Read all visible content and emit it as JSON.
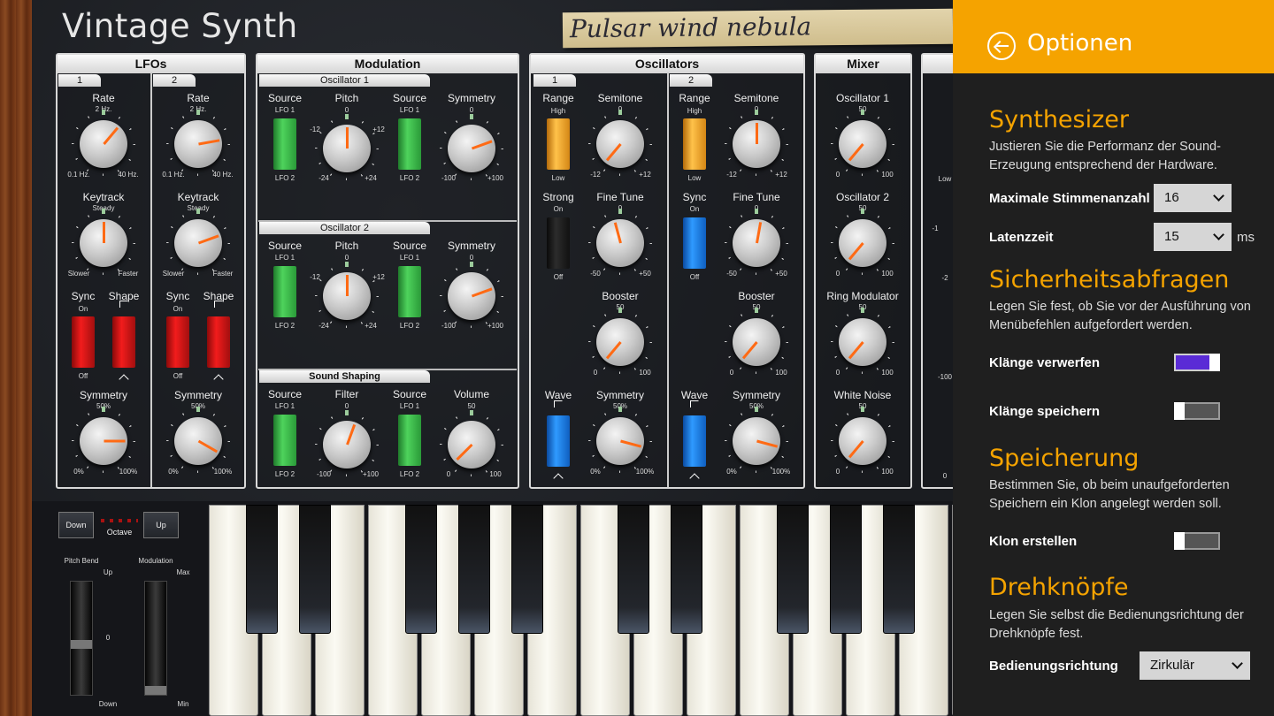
{
  "app": {
    "title": "Vintage Synth",
    "patch_name": "Pulsar wind nebula"
  },
  "panels": {
    "lfos": {
      "title": "LFOs",
      "tabs": [
        "1",
        "2"
      ],
      "columns": [
        {
          "rate": {
            "label": "Rate",
            "value": "2 Hz.",
            "min": "0.1 Hz.",
            "max": "40 Hz."
          },
          "keytrack": {
            "label": "Keytrack",
            "value": "Steady",
            "min": "Slower",
            "max": "Faster"
          },
          "sync": {
            "label": "Sync",
            "on": "On",
            "off": "Off"
          },
          "shape": {
            "label": "Shape"
          },
          "symmetry": {
            "label": "Symmetry",
            "value": "50%",
            "min": "0%",
            "max": "100%"
          }
        },
        {
          "rate": {
            "label": "Rate",
            "value": "2 Hz.",
            "min": "0.1 Hz.",
            "max": "40 Hz."
          },
          "keytrack": {
            "label": "Keytrack",
            "value": "Steady",
            "min": "Slower",
            "max": "Faster"
          },
          "sync": {
            "label": "Sync",
            "on": "On",
            "off": "Off"
          },
          "shape": {
            "label": "Shape"
          },
          "symmetry": {
            "label": "Symmetry",
            "value": "50%",
            "min": "0%",
            "max": "100%"
          }
        }
      ]
    },
    "modulation": {
      "title": "Modulation",
      "sections": [
        {
          "title": "Oscillator 1",
          "source1": "Source",
          "p1": "Pitch",
          "p1_val": "0",
          "p1_min": "-24",
          "p1_max": "+24",
          "p1_lo": "-12",
          "p1_hi": "+12",
          "source2": "Source",
          "p2": "Symmetry",
          "p2_val": "0",
          "p2_min": "-100",
          "p2_max": "+100",
          "src_top": "LFO 1",
          "src_bottom": "LFO 2"
        },
        {
          "title": "Oscillator 2",
          "source1": "Source",
          "p1": "Pitch",
          "p1_val": "0",
          "p1_min": "-24",
          "p1_max": "+24",
          "p1_lo": "-12",
          "p1_hi": "+12",
          "source2": "Source",
          "p2": "Symmetry",
          "p2_val": "0",
          "p2_min": "-100",
          "p2_max": "+100",
          "src_top": "LFO 1",
          "src_bottom": "LFO 2"
        },
        {
          "title": "Sound Shaping",
          "source1": "Source",
          "p1": "Filter",
          "p1_val": "0",
          "p1_min": "-100",
          "p1_max": "+100",
          "p1_lo": "",
          "p1_hi": "",
          "source2": "Source",
          "p2": "Volume",
          "p2_val": "50",
          "p2_min": "0",
          "p2_max": "100",
          "src_top": "LFO 1",
          "src_bottom": "LFO 2"
        }
      ]
    },
    "oscillators": {
      "title": "Oscillators",
      "tabs": [
        "1",
        "2"
      ],
      "columns": [
        {
          "range": {
            "label": "Range",
            "top": "High",
            "bottom": "Low"
          },
          "semitone": {
            "label": "Semitone",
            "value": "0",
            "min": "-12",
            "max": "+12"
          },
          "second_switch": {
            "label": "Strong",
            "top": "On",
            "bottom": "Off"
          },
          "finetune": {
            "label": "Fine Tune",
            "value": "0",
            "min": "-50",
            "max": "+50"
          },
          "booster": {
            "label": "Booster",
            "value": "50",
            "min": "0",
            "max": "100"
          },
          "wave": {
            "label": "Wave"
          },
          "symmetry": {
            "label": "Symmetry",
            "value": "50%",
            "min": "0%",
            "max": "100%"
          }
        },
        {
          "range": {
            "label": "Range",
            "top": "High",
            "bottom": "Low"
          },
          "semitone": {
            "label": "Semitone",
            "value": "0",
            "min": "-12",
            "max": "+12"
          },
          "second_switch": {
            "label": "Sync",
            "top": "On",
            "bottom": "Off"
          },
          "finetune": {
            "label": "Fine Tune",
            "value": "0",
            "min": "-50",
            "max": "+50"
          },
          "booster": {
            "label": "Booster",
            "value": "50",
            "min": "0",
            "max": "100"
          },
          "wave": {
            "label": "Wave"
          },
          "symmetry": {
            "label": "Symmetry",
            "value": "50%",
            "min": "0%",
            "max": "100%"
          }
        }
      ]
    },
    "mixer": {
      "title": "Mixer",
      "knobs": [
        {
          "label": "Oscillator 1",
          "value": "50",
          "min": "0",
          "max": "100"
        },
        {
          "label": "Oscillator 2",
          "value": "50",
          "min": "0",
          "max": "100"
        },
        {
          "label": "Ring Modulator",
          "value": "50",
          "min": "0",
          "max": "100"
        },
        {
          "label": "White Noise",
          "value": "50",
          "min": "0",
          "max": "100"
        }
      ]
    },
    "partial": {
      "labels": [
        "Low",
        "-1",
        "-2",
        "-100",
        "0"
      ]
    }
  },
  "keyboard": {
    "octave_down": "Down",
    "octave_label": "Octave",
    "octave_up": "Up",
    "pitch_bend": "Pitch Bend",
    "modulation": "Modulation",
    "pb_up": "Up",
    "pb_zero": "0",
    "pb_down": "Down",
    "mod_max": "Max",
    "mod_min": "Min"
  },
  "options": {
    "title": "Optionen",
    "synth": {
      "title": "Synthesizer",
      "desc": "Justieren Sie die Performanz der Sound-Erzeugung entsprechend der Hardware.",
      "voices_label": "Maximale Stimmenanzahl",
      "voices_value": "16",
      "latency_label": "Latenzzeit",
      "latency_value": "15",
      "latency_unit": "ms"
    },
    "security": {
      "title": "Sicherheitsabfragen",
      "desc": "Legen Sie fest, ob Sie vor der Ausführung von Menübefehlen aufgefordert werden.",
      "discard_label": "Klänge verwerfen",
      "discard_on": true,
      "save_label": "Klänge speichern",
      "save_on": false
    },
    "storage": {
      "title": "Speicherung",
      "desc": "Bestimmen Sie, ob beim unaufgeforderten Speichern ein Klon angelegt werden soll.",
      "clone_label": "Klon erstellen",
      "clone_on": false
    },
    "knobs": {
      "title": "Drehknöpfe",
      "desc": "Legen Sie selbst die Bedienungsrichtung der Drehknöpfe fest.",
      "direction_label": "Bedienungsrichtung",
      "direction_value": "Zirkulär"
    }
  },
  "colors": {
    "accent": "#f5a300",
    "options_bg": "#1f1f1f",
    "toggle_on": "#5a2bd6",
    "knob_needle": "#ff6a14"
  }
}
